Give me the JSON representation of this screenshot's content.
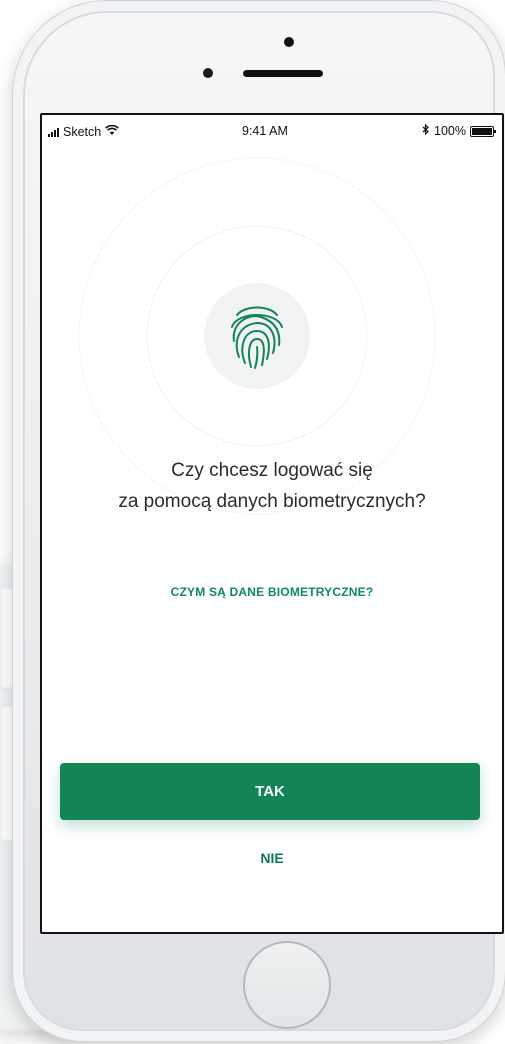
{
  "status_bar": {
    "carrier": "Sketch",
    "time": "9:41 AM",
    "battery": "100%"
  },
  "icons": {
    "fingerprint": "fingerprint-icon",
    "wifi": "wifi-icon",
    "bluetooth": "bluetooth-icon",
    "signal": "signal-icon",
    "battery": "battery-icon"
  },
  "content": {
    "question_line1": "Czy chcesz logować się",
    "question_line2": "za pomocą danych biometrycznych?",
    "info_link": "CZYM SĄ DANE BIOMETRYCZNE?"
  },
  "actions": {
    "yes_label": "TAK",
    "no_label": "NIE"
  },
  "colors": {
    "primary_green": "#138456",
    "link_green": "#0f8a5a",
    "fingerprint_circle": "#f1f3f3"
  }
}
